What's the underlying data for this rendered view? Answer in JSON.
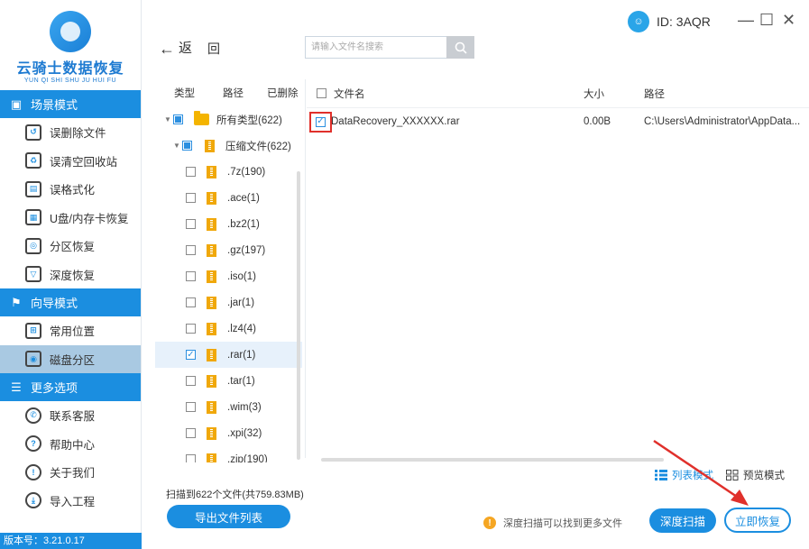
{
  "app": {
    "logo_name": "云骑士数据恢复",
    "logo_sub": "YUN QI SHI SHU JU HUI FU",
    "version": "版本号：3.21.0.17"
  },
  "sidebar": {
    "sections": [
      {
        "title": "场景模式",
        "items": [
          {
            "label": "误删除文件"
          },
          {
            "label": "误清空回收站"
          },
          {
            "label": "误格式化"
          },
          {
            "label": "U盘/内存卡恢复"
          },
          {
            "label": "分区恢复"
          },
          {
            "label": "深度恢复"
          }
        ]
      },
      {
        "title": "向导模式",
        "items": [
          {
            "label": "常用位置"
          },
          {
            "label": "磁盘分区"
          }
        ]
      },
      {
        "title": "更多选项",
        "items": [
          {
            "label": "联系客服"
          },
          {
            "label": "帮助中心"
          },
          {
            "label": "关于我们"
          },
          {
            "label": "导入工程"
          }
        ]
      }
    ],
    "active_item": "磁盘分区"
  },
  "topbar": {
    "back_label": "返",
    "forward_label": "回",
    "search_placeholder": "请输入文件名搜索",
    "account_id": "ID: 3AQR",
    "minimize": "—",
    "maximize": "☐",
    "close": "✕"
  },
  "tree": {
    "tabs": [
      "类型",
      "路径",
      "已删除"
    ],
    "root": "所有类型(622)",
    "group": "压缩文件(622)",
    "children": [
      {
        "label": ".7z(190)",
        "checked": false
      },
      {
        "label": ".ace(1)",
        "checked": false
      },
      {
        "label": ".bz2(1)",
        "checked": false
      },
      {
        "label": ".gz(197)",
        "checked": false
      },
      {
        "label": ".iso(1)",
        "checked": false
      },
      {
        "label": ".jar(1)",
        "checked": false
      },
      {
        "label": ".lz4(4)",
        "checked": false
      },
      {
        "label": ".rar(1)",
        "checked": true
      },
      {
        "label": ".tar(1)",
        "checked": false
      },
      {
        "label": ".wim(3)",
        "checked": false
      },
      {
        "label": ".xpi(32)",
        "checked": false
      },
      {
        "label": ".zip(190)",
        "checked": false
      }
    ]
  },
  "file_table": {
    "columns": {
      "name": "文件名",
      "size": "大小",
      "path": "路径"
    },
    "rows": [
      {
        "name": "DataRecovery_XXXXXX.rar",
        "size": "0.00B",
        "path": "C:\\Users\\Administrator\\AppData...",
        "checked": true
      }
    ]
  },
  "view": {
    "list_mode": "列表模式",
    "preview_mode": "预览模式"
  },
  "footer": {
    "scan_info": "扫描到622个文件(共759.83MB)",
    "export_button": "导出文件列表",
    "hint": "深度扫描可以找到更多文件",
    "deep_scan_button": "深度扫描",
    "recover_button": "立即恢复"
  },
  "colors": {
    "accent": "#1b8ee0",
    "highlight": "#e0302b",
    "folder": "#f4b400"
  }
}
